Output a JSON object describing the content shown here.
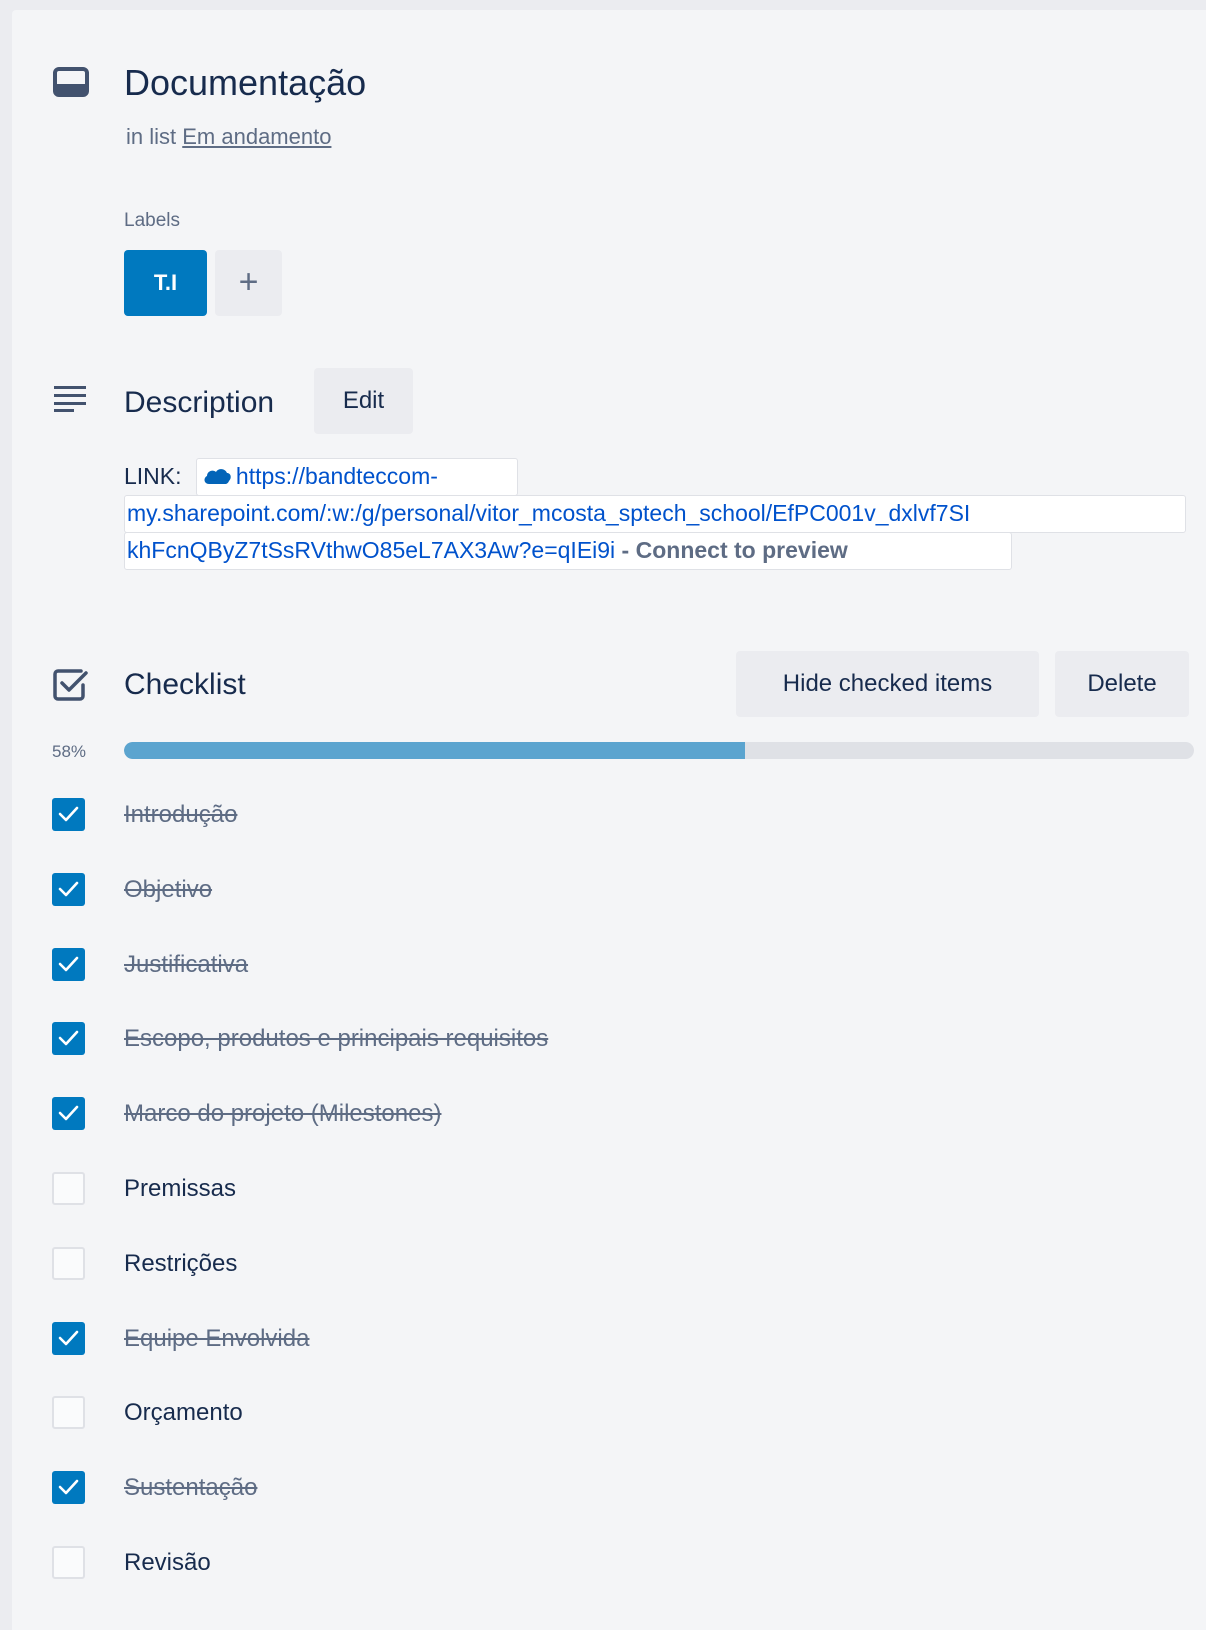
{
  "card": {
    "title": "Documentação",
    "in_list_prefix": "in list",
    "list_name": "Em andamento"
  },
  "labels": {
    "heading": "Labels",
    "items": [
      {
        "text": "T.I",
        "color": "#0079bf"
      }
    ],
    "add_symbol": "+"
  },
  "description": {
    "title": "Description",
    "edit_label": "Edit",
    "link_prefix": "LINK:",
    "link_icon": "onedrive-cloud-icon",
    "url_line_1": "https://bandteccom-",
    "url_line_2": "my.sharepoint.com/:w:/g/personal/vitor_mcosta_sptech_school/EfPC001v_dxlvf7SI",
    "url_line_3": "khFcnQByZ7tSsRVthwO85eL7AX3Aw?e=qIEi9i",
    "preview_separator": " - ",
    "preview_label": "Connect to preview"
  },
  "checklist": {
    "title": "Checklist",
    "hide_checked_label": "Hide checked items",
    "delete_label": "Delete",
    "progress_label": "58%",
    "progress_value": 0.58,
    "items": [
      {
        "text": "Introdução",
        "checked": true
      },
      {
        "text": "Objetivo",
        "checked": true
      },
      {
        "text": "Justificativa",
        "checked": true
      },
      {
        "text": "Escopo, produtos e principais requisitos",
        "checked": true
      },
      {
        "text": "Marco do projeto (Milestones)",
        "checked": true
      },
      {
        "text": "Premissas",
        "checked": false
      },
      {
        "text": "Restrições",
        "checked": false
      },
      {
        "text": "Equipe Envolvida",
        "checked": true
      },
      {
        "text": "Orçamento",
        "checked": false
      },
      {
        "text": "Sustentação",
        "checked": true
      },
      {
        "text": "Revisão",
        "checked": false
      }
    ]
  },
  "colors": {
    "accent": "#0079bf",
    "progress": "#5ba4cf",
    "link": "#0052cc"
  }
}
